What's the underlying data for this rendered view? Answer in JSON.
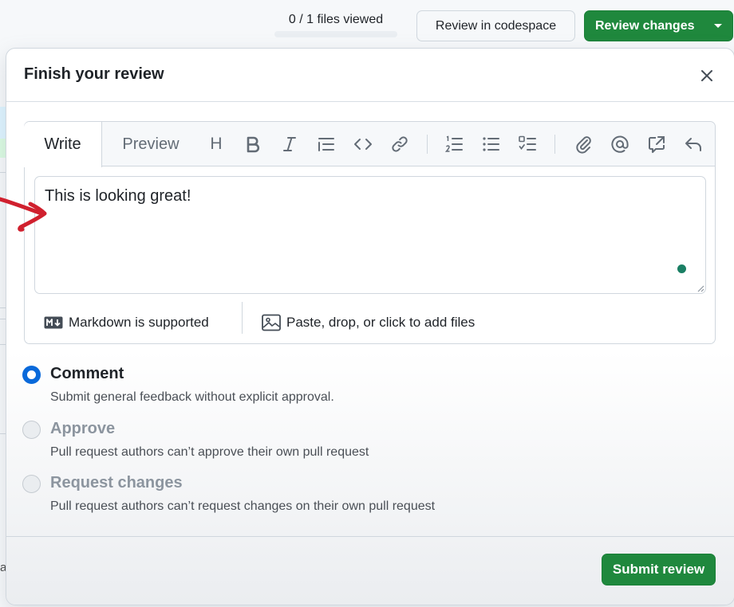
{
  "topbar": {
    "files_viewed": "0 / 1 files viewed",
    "files_viewed_progress": 0,
    "codespace_button": "Review in codespace",
    "review_button": "Review changes"
  },
  "review": {
    "title": "Finish your review",
    "tabs": [
      "Write",
      "Preview"
    ],
    "toolbar_heading_glyph": "H",
    "toolbar_icons": [
      "heading-icon",
      "bold-icon",
      "italic-icon",
      "quote-icon",
      "code-icon",
      "link-icon",
      "numbered-list-icon",
      "bulleted-list-icon",
      "task-list-icon",
      "paperclip-icon",
      "mention-icon",
      "cross-reference-icon",
      "saved-reply-icon"
    ],
    "comment_text": "This is looking great!",
    "markdown_note": "Markdown is supported",
    "attach_note": "Paste, drop, or click to add files",
    "options": [
      {
        "label": "Comment",
        "desc": "Submit general feedback without explicit approval.",
        "selected": true,
        "disabled": false
      },
      {
        "label": "Approve",
        "desc": "Pull request authors can’t approve their own pull request",
        "selected": false,
        "disabled": true
      },
      {
        "label": "Request changes",
        "desc": "Pull request authors can’t request changes on their own pull request",
        "selected": false,
        "disabled": true
      }
    ],
    "submit_button": "Submit review"
  },
  "background": {
    "partial_letter": "a"
  },
  "colors": {
    "primary_green": "#1f883d",
    "selected_blue": "#0969da",
    "annotation_red": "#d0202e",
    "status_dot": "#1a7f64"
  }
}
